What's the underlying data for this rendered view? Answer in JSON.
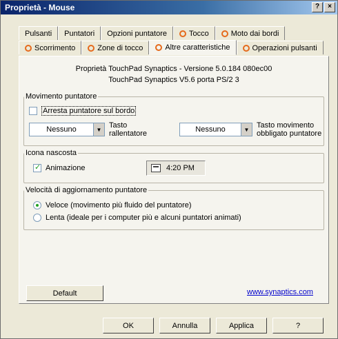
{
  "window": {
    "title": "Proprietà - Mouse",
    "help_btn": "?",
    "close_btn": "×"
  },
  "tabs_row1": [
    {
      "label": "Pulsanti",
      "icon": false
    },
    {
      "label": "Puntatori",
      "icon": false
    },
    {
      "label": "Opzioni puntatore",
      "icon": false
    },
    {
      "label": "Tocco",
      "icon": true
    },
    {
      "label": "Moto dai bordi",
      "icon": true
    }
  ],
  "tabs_row2": [
    {
      "label": "Scorrimento",
      "icon": true
    },
    {
      "label": "Zone di tocco",
      "icon": true
    },
    {
      "label": "Altre caratteristiche",
      "icon": true,
      "active": true
    },
    {
      "label": "Operazioni pulsanti",
      "icon": true
    }
  ],
  "info": {
    "line1": "Proprietà TouchPad Synaptics - Versione 5.0.184 080ec00",
    "line2": "TouchPad Synaptics V5.6 porta PS/2 3"
  },
  "movimento": {
    "legend": "Movimento puntatore",
    "arresta_label": "Arresta puntatore sul bordo",
    "arresta_checked": false,
    "select1_value": "Nessuno",
    "select1_label_line1": "Tasto",
    "select1_label_line2": "rallentatore",
    "select2_value": "Nessuno",
    "select2_label_line1": "Tasto movimento",
    "select2_label_line2": "obbligato puntatore"
  },
  "icona": {
    "legend": "Icona nascosta",
    "animazione_label": "Animazione",
    "animazione_checked": true,
    "time": "4:20 PM"
  },
  "velocita": {
    "legend": "Velocità di aggiornamento puntatore",
    "option1": "Veloce (movimento più fluido del puntatore)",
    "option2": "Lenta (ideale per i computer più e alcuni puntatori animati)",
    "selected": 1
  },
  "default_button": "Default",
  "link": "www.synaptics.com",
  "buttons": {
    "ok": "OK",
    "cancel": "Annulla",
    "apply": "Applica",
    "help": "?"
  }
}
